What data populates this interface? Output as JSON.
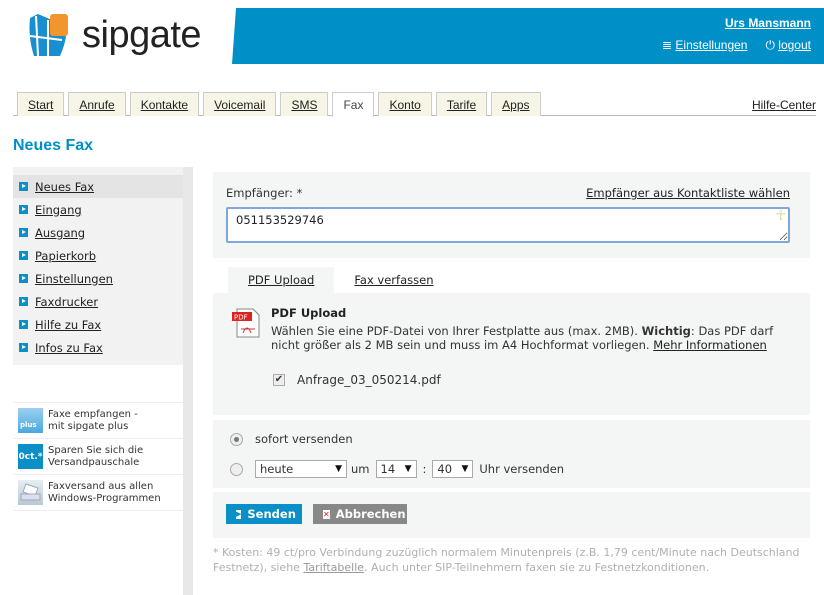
{
  "header": {
    "brand": "sipgate",
    "user": "Urs Mansmann",
    "settings": "Einstellungen",
    "logout": "logout"
  },
  "tabs": [
    {
      "label": "Start"
    },
    {
      "label": "Anrufe"
    },
    {
      "label": "Kontakte"
    },
    {
      "label": "Voicemail"
    },
    {
      "label": "SMS"
    },
    {
      "label": "Fax",
      "active": true
    },
    {
      "label": "Konto"
    },
    {
      "label": "Tarife"
    },
    {
      "label": "Apps"
    }
  ],
  "help": "Hilfe-Center",
  "page_title": "Neues Fax",
  "sidebar": {
    "items": [
      {
        "label": "Neues Fax"
      },
      {
        "label": "Eingang"
      },
      {
        "label": "Ausgang"
      },
      {
        "label": "Papierkorb"
      },
      {
        "label": "Einstellungen"
      },
      {
        "label": "Faxdrucker"
      },
      {
        "label": "Hilfe zu Fax"
      },
      {
        "label": "Infos zu Fax"
      }
    ],
    "promos": [
      {
        "line1": "Faxe empfangen -",
        "line2": "mit sipgate plus",
        "icon_text": "plus"
      },
      {
        "line1": "Sparen Sie sich die",
        "line2": "Versandpauschale",
        "icon_text": "0ct.*"
      },
      {
        "line1": "Faxversand aus allen",
        "line2": "Windows-Programmen"
      }
    ]
  },
  "recipient": {
    "label": "Empfänger: *",
    "pick_link": "Empfänger aus Kontaktliste wählen",
    "value": "051153529746"
  },
  "subtabs": [
    "PDF Upload",
    "Fax verfassen"
  ],
  "upload": {
    "title": "PDF Upload",
    "desc": "Wählen Sie eine PDF-Datei von Ihrer Festplatte aus (max. 2MB). ",
    "important": "Wichtig",
    "desc2": ": Das PDF darf nicht größer als 2 MB sein und muss im A4 Hochformat vorliegen. ",
    "more": "Mehr Informationen",
    "file": "Anfrage_03_050214.pdf",
    "pdf_badge": "PDF"
  },
  "schedule": {
    "now": "sofort versenden",
    "day": "heute",
    "at": "um",
    "hour": "14",
    "minute": "40",
    "suffix": "Uhr versenden"
  },
  "buttons": {
    "send": "Senden",
    "cancel": "Abbrechen"
  },
  "footnote": {
    "text1": "* Kosten: 49 ct/pro Verbindung zuzüglich normalem Minutenpreis (z.B. 1,79 cent/Minute nach Deutschland Festnetz), siehe ",
    "link": "Tariftabelle",
    "text2": ". Auch unter SIP-Teilnehmern faxen sie zu Festnetzkonditionen."
  },
  "colors": {
    "brand": "#0090c8",
    "logo_orange": "#f0962c"
  }
}
